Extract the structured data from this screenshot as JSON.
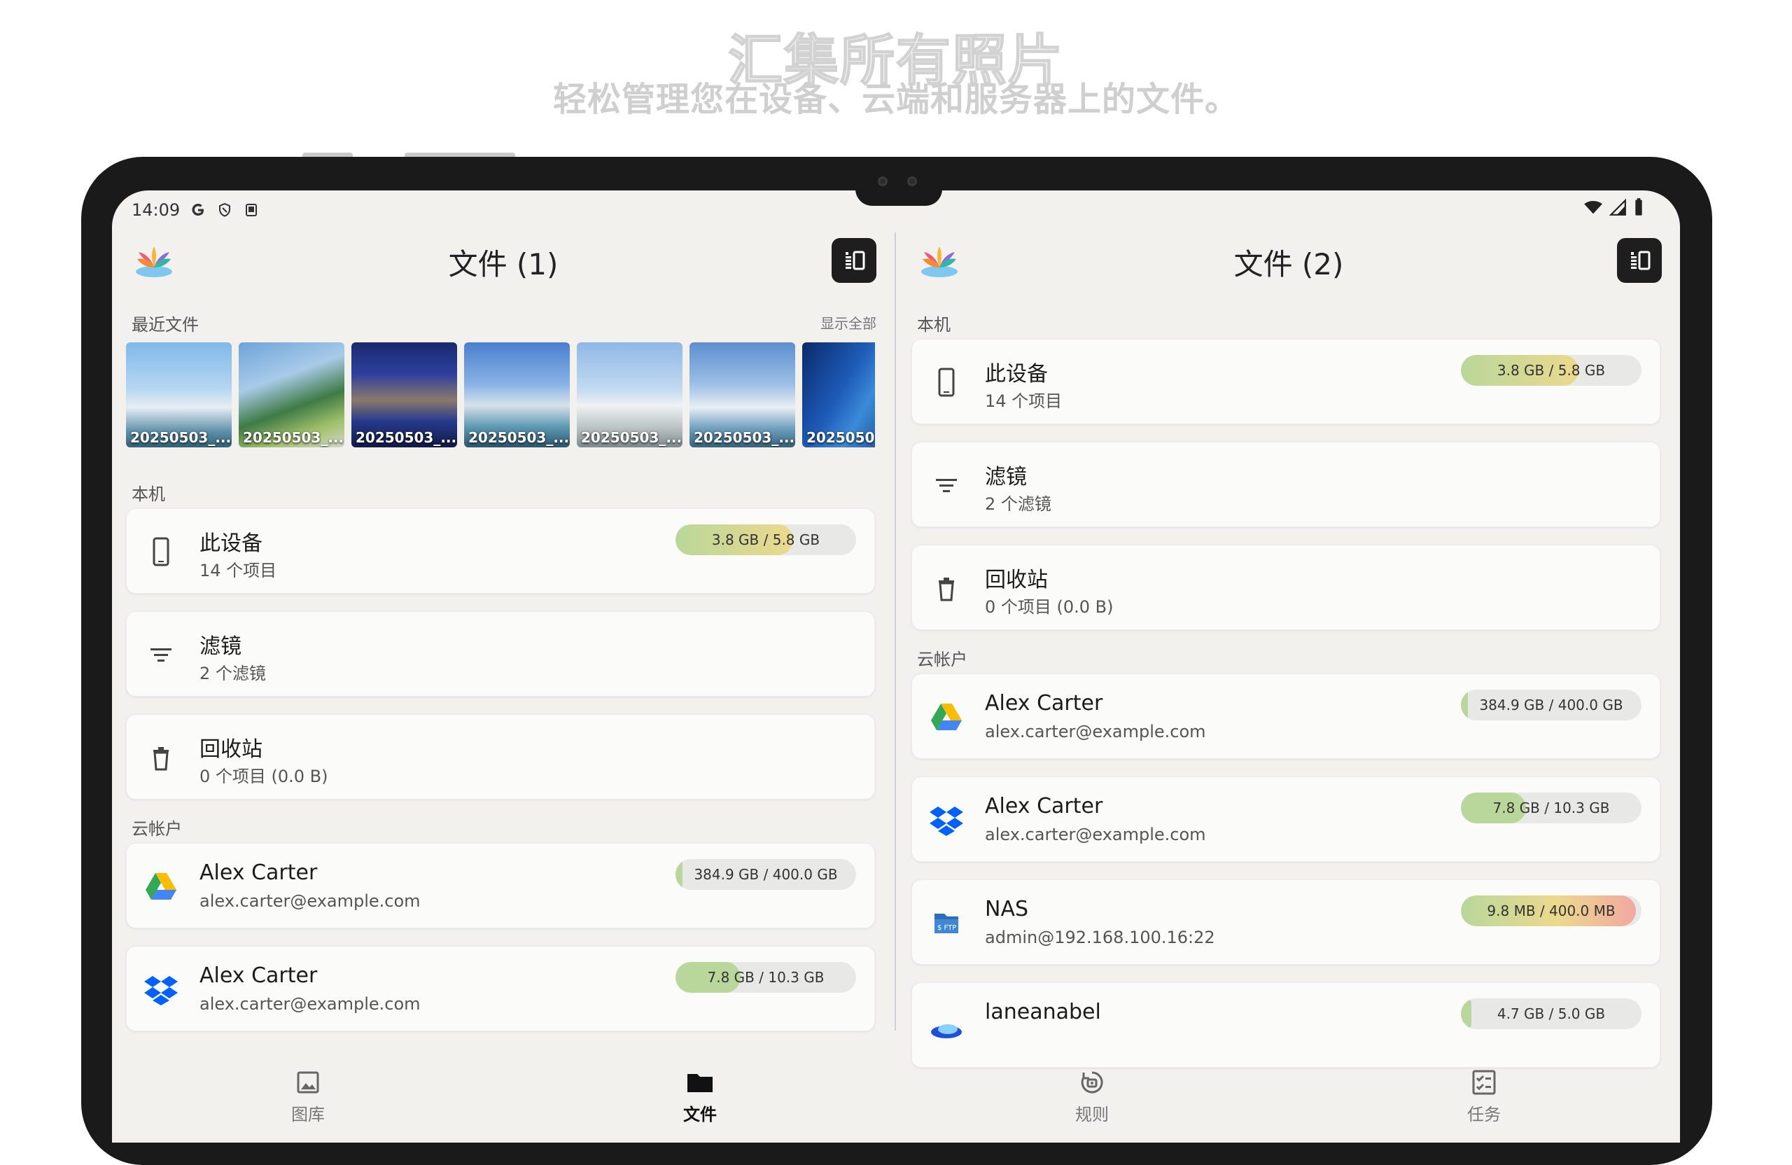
{
  "promo": {
    "title": "汇集所有照片",
    "subtitle": "轻松管理您在设备、云端和服务器上的文件。"
  },
  "status_bar": {
    "time": "14:09",
    "icons": [
      "google-icon",
      "shield-icon",
      "screen-icon",
      "wifi-icon",
      "signal-icon",
      "battery-icon"
    ]
  },
  "left_pane": {
    "title": "文件 (1)",
    "recent": {
      "label": "最近文件",
      "show_all": "显示全部",
      "items": [
        "20250503_...",
        "20250503_...",
        "20250503_...",
        "20250503_...",
        "20250503_...",
        "20250503_...",
        "2025050"
      ]
    },
    "local_label": "本机",
    "local": [
      {
        "name": "此设备",
        "detail": "14 个项目",
        "quota": "3.8 GB / 5.8 GB",
        "fraction": 0.65,
        "icon": "phone-icon"
      },
      {
        "name": "滤镜",
        "detail": "2 个滤镜",
        "icon": "filter-icon"
      },
      {
        "name": "回收站",
        "detail": "0 个项目 (0.0 B)",
        "icon": "trash-icon"
      }
    ],
    "cloud_label": "云帐户",
    "cloud": [
      {
        "name": "Alex Carter",
        "detail": "alex.carter@example.com",
        "quota": "384.9 GB / 400.0 GB",
        "fraction": 0.04,
        "icon": "google-drive-icon"
      },
      {
        "name": "Alex Carter",
        "detail": "alex.carter@example.com",
        "quota": "7.8 GB / 10.3 GB",
        "fraction": 0.36,
        "icon": "dropbox-icon"
      }
    ]
  },
  "right_pane": {
    "title": "文件 (2)",
    "local_label": "本机",
    "local": [
      {
        "name": "此设备",
        "detail": "14 个项目",
        "quota": "3.8 GB / 5.8 GB",
        "fraction": 0.65,
        "icon": "phone-icon"
      },
      {
        "name": "滤镜",
        "detail": "2 个滤镜",
        "icon": "filter-icon"
      },
      {
        "name": "回收站",
        "detail": "0 个项目 (0.0 B)",
        "icon": "trash-icon"
      }
    ],
    "cloud_label": "云帐户",
    "cloud": [
      {
        "name": "Alex Carter",
        "detail": "alex.carter@example.com",
        "quota": "384.9 GB / 400.0 GB",
        "fraction": 0.04,
        "icon": "google-drive-icon"
      },
      {
        "name": "Alex Carter",
        "detail": "alex.carter@example.com",
        "quota": "7.8 GB / 10.3 GB",
        "fraction": 0.36,
        "icon": "dropbox-icon"
      },
      {
        "name": "NAS",
        "detail": "admin@192.168.100.16:22",
        "quota": "9.8 MB / 400.0 MB",
        "fraction": 0.97,
        "icon": "sftp-icon"
      },
      {
        "name": "laneanabel",
        "detail": "",
        "quota": "4.7 GB / 5.0 GB",
        "fraction": 0.06,
        "icon": "cloud-icon"
      }
    ]
  },
  "bottom_nav": [
    {
      "label": "图库",
      "icon": "gallery-icon",
      "active": false
    },
    {
      "label": "文件",
      "icon": "folder-icon",
      "active": true
    },
    {
      "label": "规则",
      "icon": "rules-icon",
      "active": false
    },
    {
      "label": "任务",
      "icon": "tasks-icon",
      "active": false
    }
  ],
  "colors": {
    "background": "#f2f1ee",
    "card": "#fbfbfa",
    "quota_green": "#b9d79a",
    "quota_yellow": "#ecd98e",
    "quota_red": "#f2a8a0"
  }
}
